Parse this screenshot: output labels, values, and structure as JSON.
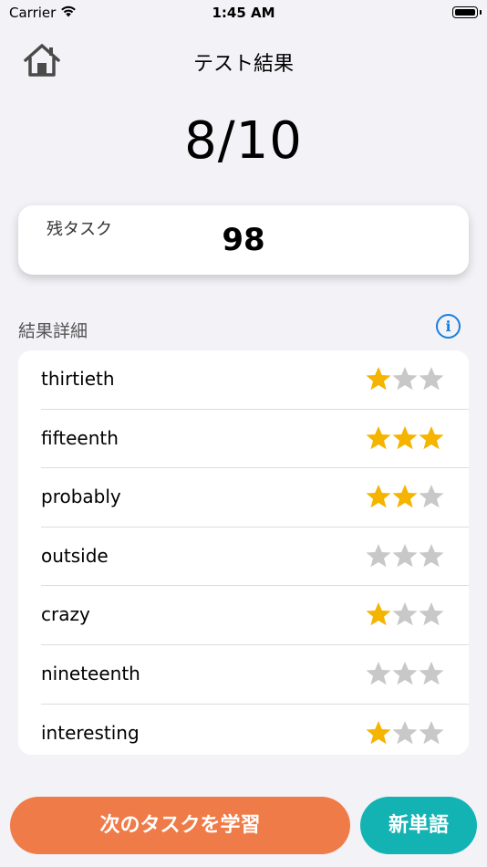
{
  "status_bar": {
    "carrier": "Carrier",
    "time": "1:45 AM"
  },
  "header": {
    "title": "テスト結果",
    "home_icon": "home-icon"
  },
  "score": "8/10",
  "task_card": {
    "label": "残タスク",
    "value": "98"
  },
  "results": {
    "title": "結果詳細",
    "info_icon": "info-icon",
    "items": [
      {
        "word": "thirtieth",
        "stars": 1
      },
      {
        "word": "fifteenth",
        "stars": 3
      },
      {
        "word": "probably",
        "stars": 2
      },
      {
        "word": "outside",
        "stars": 0
      },
      {
        "word": "crazy",
        "stars": 1
      },
      {
        "word": "nineteenth",
        "stars": 0
      },
      {
        "word": "interesting",
        "stars": 1
      }
    ]
  },
  "buttons": {
    "next_task": "次のタスクを学習",
    "new_words": "新単語"
  },
  "colors": {
    "star_filled": "#f5b400",
    "star_empty": "#c8c8c8",
    "next_button": "#ef7b48",
    "new_button": "#13b3b3",
    "info_accent": "#1a7fe0"
  }
}
